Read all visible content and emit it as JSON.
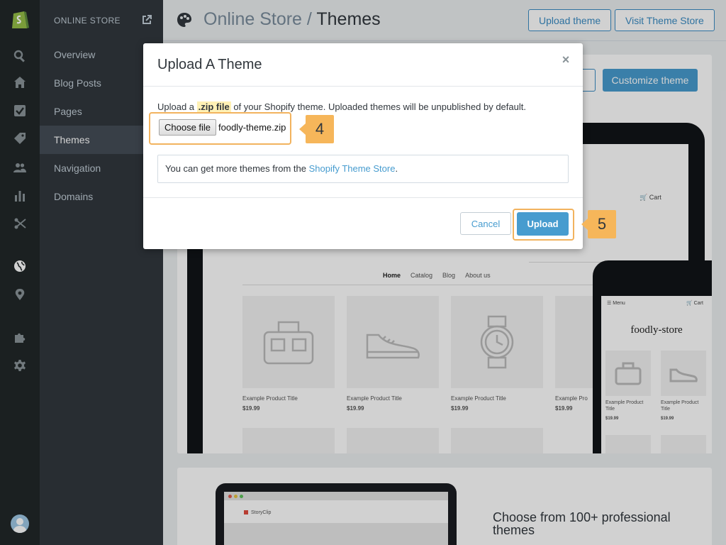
{
  "rail": {
    "icons": [
      "shopify-logo-icon",
      "search-icon",
      "home-icon",
      "orders-icon",
      "products-icon",
      "customers-icon",
      "reports-icon",
      "discounts-icon",
      "online-store-globe-icon",
      "location-icon",
      "apps-puzzle-icon",
      "settings-gear-icon",
      "avatar"
    ]
  },
  "sidebar": {
    "section_title": "ONLINE STORE",
    "items": [
      {
        "label": "Overview"
      },
      {
        "label": "Blog Posts"
      },
      {
        "label": "Pages"
      },
      {
        "label": "Themes",
        "active": true
      },
      {
        "label": "Navigation"
      },
      {
        "label": "Domains"
      }
    ]
  },
  "header": {
    "breadcrumb_section": "Online Store",
    "separator": " / ",
    "page_title": "Themes",
    "upload_theme_label": "Upload theme",
    "visit_store_label": "Visit Theme Store"
  },
  "theme_card": {
    "customize_label": "Customize theme",
    "store": {
      "cart_label": "Cart",
      "nav": [
        "Home",
        "Catalog",
        "Blog",
        "About us"
      ],
      "products": [
        {
          "title": "Example Product Title",
          "price": "$19.99"
        },
        {
          "title": "Example Product Title",
          "price": "$19.99"
        },
        {
          "title": "Example Product Title",
          "price": "$19.99"
        },
        {
          "title": "Example Pro",
          "price": "$19.99"
        }
      ]
    },
    "phone": {
      "menu_label": "Menu",
      "cart_label": "Cart",
      "store_name": "foodly-store",
      "products": [
        {
          "title": "Example Product Title",
          "price": "$19.99"
        },
        {
          "title": "Example Product Title",
          "price": "$19.99"
        }
      ]
    }
  },
  "promo_card": {
    "brand": "StoryClip",
    "heading": "Choose from 100+ professional themes"
  },
  "modal": {
    "title": "Upload A Theme",
    "close": "×",
    "desc_before": "Upload a ",
    "desc_highlight": ".zip file",
    "desc_after": " of your Shopify theme. Uploaded themes will be unpublished by default.",
    "choose_file_label": "Choose file",
    "file_name": "foodly-theme.zip",
    "info_text": "You can get more themes from the ",
    "info_link": "Shopify Theme Store",
    "info_end": ".",
    "cancel_label": "Cancel",
    "upload_label": "Upload",
    "step_file": "4",
    "step_upload": "5"
  },
  "colors": {
    "accent": "#479ccf",
    "highlight": "#f6b65a",
    "sidebar_dark": "#31373d",
    "rail_dark": "#222829"
  }
}
